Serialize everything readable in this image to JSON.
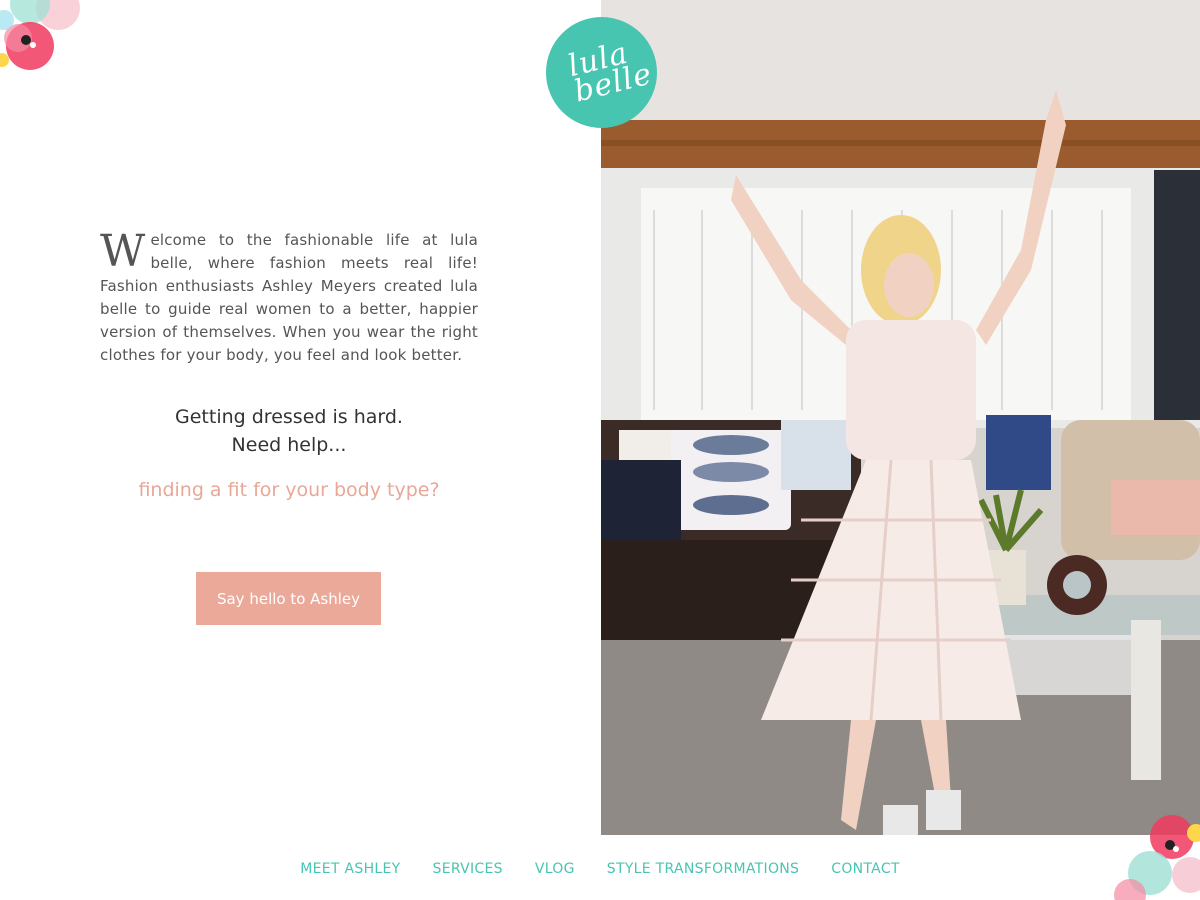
{
  "logo": {
    "line1": "lula",
    "line2": "belle"
  },
  "intro": {
    "dropcap": "W",
    "text": "elcome to the fashionable life at lula belle, where fashion meets real life! Fashion enthusiasts Ashley Meyers created lula belle to guide real women to a better, happier version of themselves. When you wear the right clothes for your body, you feel and look better."
  },
  "tagline": {
    "line1": "Getting dressed is hard.",
    "line2": "Need help..."
  },
  "rotator_text": "finding a fit for your body type?",
  "cta_label": "Say hello to Ashley",
  "nav": [
    {
      "label": "MEET ASHLEY"
    },
    {
      "label": "SERVICES"
    },
    {
      "label": "VLOG"
    },
    {
      "label": "STYLE TRANSFORMATIONS"
    },
    {
      "label": "CONTACT"
    }
  ],
  "colors": {
    "brand_teal": "#48c5b1",
    "accent_pink": "#eba99a",
    "text_dark": "#555555"
  },
  "hero": {
    "image": "hero-photo"
  }
}
